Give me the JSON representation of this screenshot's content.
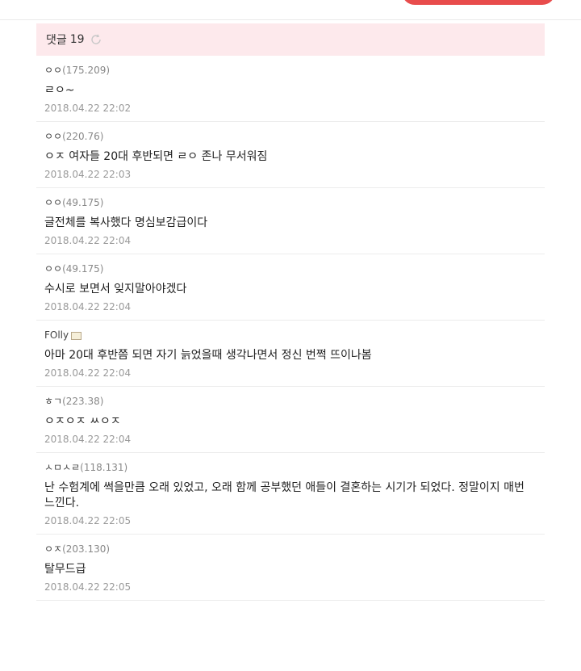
{
  "header": {
    "comments_label": "댓글",
    "comments_count": "19"
  },
  "icons": {
    "refresh": "refresh-icon",
    "author_badge": "badge-icon"
  },
  "colors": {
    "header_bg": "#fde9ec",
    "accent_red": "#e84c4c",
    "timestamp": "#999999"
  },
  "comments": [
    {
      "name": "ㅇㅇ",
      "ip": "(175.209)",
      "text": "ㄹㅇ~",
      "time": "2018.04.22 22:02"
    },
    {
      "name": "ㅇㅇ",
      "ip": "(220.76)",
      "text": "ㅇㅈ 여자들 20대 후반되면 ㄹㅇ 존나 무서워짐",
      "time": "2018.04.22 22:03"
    },
    {
      "name": "ㅇㅇ",
      "ip": "(49.175)",
      "text": "글전체를 복사했다 명심보감급이다",
      "time": "2018.04.22 22:04"
    },
    {
      "name": "ㅇㅇ",
      "ip": "(49.175)",
      "text": "수시로 보면서 잊지말아야겠다",
      "time": "2018.04.22 22:04"
    },
    {
      "name": "FOlly",
      "ip": "",
      "badge": true,
      "text": "아마 20대 후반쯤 되면 자기 늙었을때 생각나면서 정신 번쩍 뜨이나봄",
      "time": "2018.04.22 22:04"
    },
    {
      "name": "ㅎㄱ",
      "ip": "(223.38)",
      "text": "ㅇㅈㅇㅈ ㅆㅇㅈ",
      "time": "2018.04.22 22:04"
    },
    {
      "name": "ㅅㅁㅅㄹ",
      "ip": "(118.131)",
      "text": "난 수험계에 썩을만큼 오래 있었고, 오래 함께 공부했던 애들이 결혼하는 시기가 되었다. 정말이지 매번 느낀다.",
      "time": "2018.04.22 22:05"
    },
    {
      "name": "ㅇㅈ",
      "ip": "(203.130)",
      "text": "탈무드급",
      "time": "2018.04.22 22:05"
    }
  ]
}
